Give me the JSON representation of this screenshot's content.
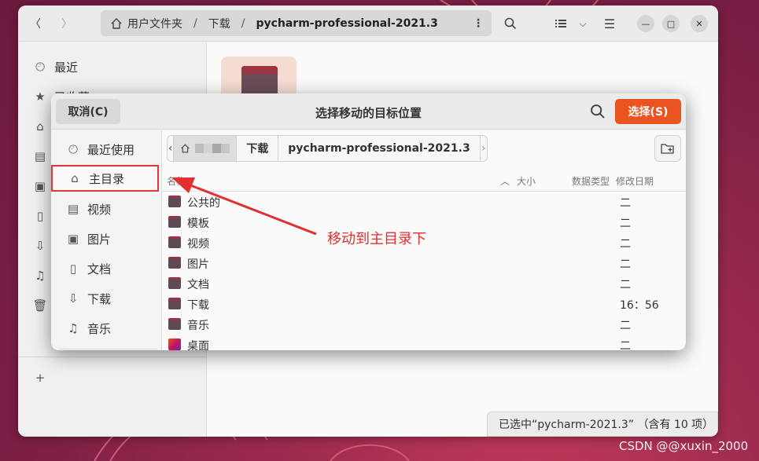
{
  "main_window": {
    "path": [
      "用户文件夹",
      "下载",
      "pycharm-professional-2021.3"
    ],
    "sidebar": [
      {
        "label": "最近",
        "icon": "clock-icon"
      },
      {
        "label": "已收藏",
        "icon": "star-icon"
      }
    ],
    "status": "已选中“pycharm-2021.3” （含有 10 项）"
  },
  "dialog": {
    "cancel_label": "取消(C)",
    "title": "选择移动的目标位置",
    "select_label": "选择(S)",
    "sidebar": [
      {
        "label": "最近使用",
        "icon": "clock-icon"
      },
      {
        "label": "主目录",
        "icon": "home-icon"
      },
      {
        "label": "视频",
        "icon": "film-icon"
      },
      {
        "label": "图片",
        "icon": "image-icon"
      },
      {
        "label": "文档",
        "icon": "document-icon"
      },
      {
        "label": "下载",
        "icon": "download-icon"
      },
      {
        "label": "音乐",
        "icon": "music-icon"
      }
    ],
    "path": [
      "下载",
      "pycharm-professional-2021.3"
    ],
    "columns": {
      "name": "名称",
      "size": "大小",
      "type": "数据类型",
      "modified": "修改日期"
    },
    "files": [
      {
        "name": "公共的",
        "modified": "二"
      },
      {
        "name": "模板",
        "modified": "二"
      },
      {
        "name": "视频",
        "modified": "二"
      },
      {
        "name": "图片",
        "modified": "二"
      },
      {
        "name": "文档",
        "modified": "二"
      },
      {
        "name": "下载",
        "modified": "16：56"
      },
      {
        "name": "音乐",
        "modified": "二"
      },
      {
        "name": "桌面",
        "modified": "二"
      }
    ]
  },
  "annotation": "移动到主目录下",
  "watermark": "CSDN @@xuxin_2000",
  "colors": {
    "accent": "#e95420",
    "annotation": "#e03030"
  }
}
